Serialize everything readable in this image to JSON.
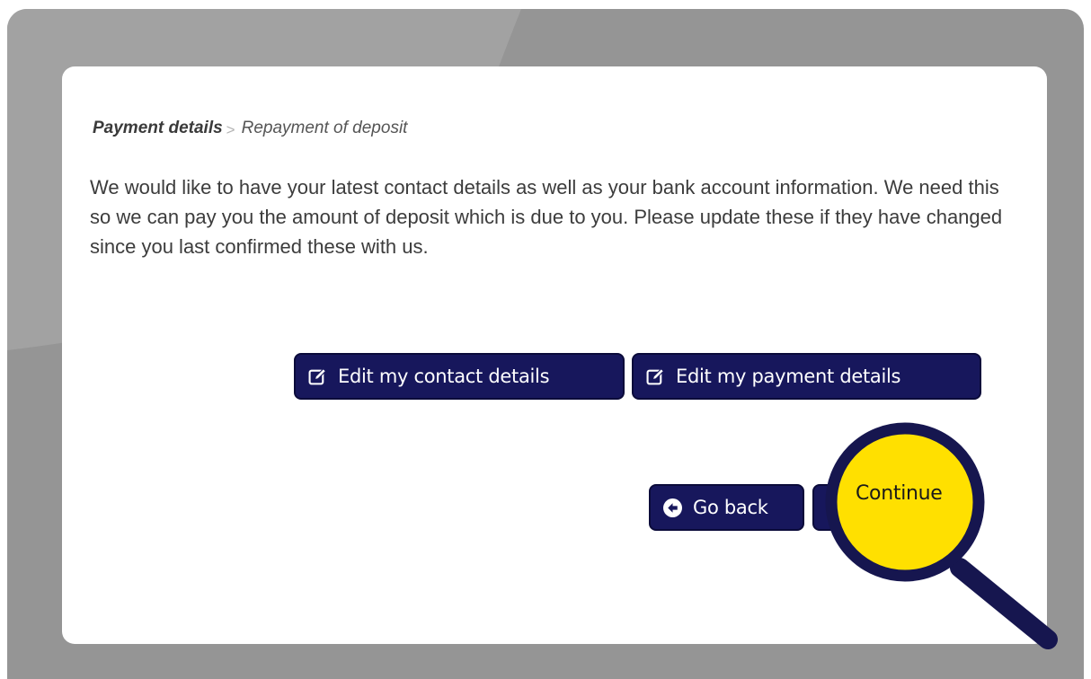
{
  "breadcrumb": {
    "current": "Payment details",
    "separator": ">",
    "next": "Repayment of deposit"
  },
  "intro_text": "We would like to have your latest contact details as well as your bank account information. We need this so we can pay you the amount of deposit which is due to you. Please update these if they have changed since you last confirmed these with us.",
  "buttons": {
    "edit_contact": {
      "label": "Edit my contact details",
      "icon": "edit-icon"
    },
    "edit_payment": {
      "label": "Edit my payment details",
      "icon": "edit-icon"
    },
    "go_back": {
      "label": "Go back",
      "icon": "arrow-left-circle-icon"
    },
    "continue": {
      "label": "Continue",
      "icon": "arrow-right-circle-icon"
    }
  },
  "magnifier": {
    "label": "Continue",
    "icon": "magnifying-glass-icon"
  },
  "colors": {
    "frame": "#959595",
    "button": "#17175c",
    "highlight": "#ffe000",
    "magnifier_ring": "#16164f"
  }
}
